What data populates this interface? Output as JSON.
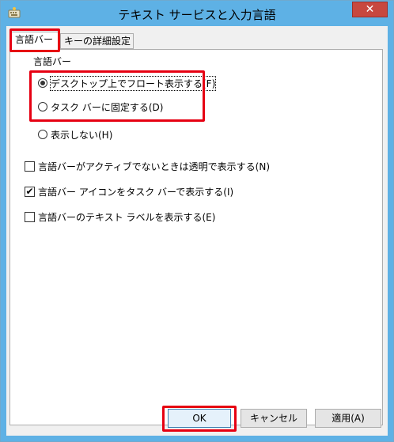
{
  "window": {
    "title": "テキスト サービスと入力言語",
    "close_glyph": "✕"
  },
  "tabs": [
    {
      "label": "言語バー",
      "active": true
    },
    {
      "label": "キーの詳細設定",
      "active": false
    }
  ],
  "language_bar_group": {
    "legend": "言語バー",
    "options": [
      {
        "label": "デスクトップ上でフロート表示する(F)",
        "selected": true
      },
      {
        "label": "タスク バーに固定する(D)",
        "selected": false
      },
      {
        "label": "表示しない(H)",
        "selected": false
      }
    ]
  },
  "checkboxes": [
    {
      "label": "言語バーがアクティブでないときは透明で表示する(N)",
      "checked": false
    },
    {
      "label": "言語バー アイコンをタスク バーで表示する(I)",
      "checked": true
    },
    {
      "label": "言語バーのテキスト ラベルを表示する(E)",
      "checked": false
    }
  ],
  "buttons": {
    "ok": "OK",
    "cancel": "キャンセル",
    "apply": "適用(A)"
  },
  "colors": {
    "highlight": "#e60012",
    "titlebar": "#5eb1e5"
  }
}
